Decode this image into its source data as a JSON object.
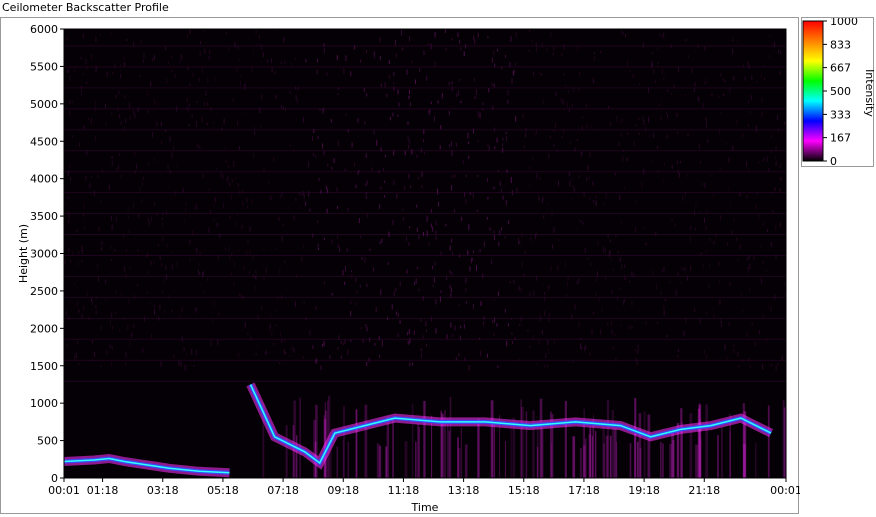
{
  "window": {
    "title": "Ceilometer Backscatter Profile"
  },
  "chart_data": {
    "type": "heatmap",
    "xlabel": "Time",
    "ylabel": "Height (m)",
    "x_ticks": [
      "00:01",
      "01:18",
      "03:18",
      "05:18",
      "07:18",
      "09:18",
      "11:18",
      "13:18",
      "15:18",
      "17:18",
      "19:18",
      "21:18",
      "00:01"
    ],
    "x_tick_hours": [
      0,
      1.283,
      3.283,
      5.283,
      7.283,
      9.283,
      11.283,
      13.283,
      15.283,
      17.283,
      19.283,
      21.283,
      24
    ],
    "y_ticks": [
      0,
      500,
      1000,
      1500,
      2000,
      2500,
      3000,
      3500,
      4000,
      4500,
      5000,
      5500,
      6000
    ],
    "ylim": [
      0,
      6000
    ],
    "xlim_hours": [
      0,
      24
    ],
    "colorbar": {
      "label": "Intensity",
      "ticks": [
        "1000",
        "833",
        "667",
        "500",
        "333",
        "167",
        "0"
      ],
      "range": [
        0,
        1000
      ],
      "colors": [
        "#ff0000",
        "#ff8000",
        "#ffff00",
        "#00ff00",
        "#00ffff",
        "#0000ff",
        "#ff00ff",
        "#000000"
      ]
    },
    "cloud_base_layer": [
      {
        "hour": 0.0,
        "height": 220
      },
      {
        "hour": 0.5,
        "height": 230
      },
      {
        "hour": 1.0,
        "height": 240
      },
      {
        "hour": 1.5,
        "height": 260
      },
      {
        "hour": 2.0,
        "height": 220
      },
      {
        "hour": 2.5,
        "height": 190
      },
      {
        "hour": 3.0,
        "height": 160
      },
      {
        "hour": 3.5,
        "height": 130
      },
      {
        "hour": 4.0,
        "height": 110
      },
      {
        "hour": 4.5,
        "height": 90
      },
      {
        "hour": 5.0,
        "height": 80
      },
      {
        "hour": 5.5,
        "height": 70
      },
      {
        "hour": 6.2,
        "height": 1250
      },
      {
        "hour": 7.0,
        "height": 550
      },
      {
        "hour": 7.5,
        "height": 450
      },
      {
        "hour": 8.0,
        "height": 350
      },
      {
        "hour": 8.5,
        "height": 200
      },
      {
        "hour": 9.0,
        "height": 600
      },
      {
        "hour": 10.0,
        "height": 700
      },
      {
        "hour": 11.0,
        "height": 800
      },
      {
        "hour": 12.5,
        "height": 750
      },
      {
        "hour": 14.0,
        "height": 750
      },
      {
        "hour": 15.5,
        "height": 700
      },
      {
        "hour": 17.0,
        "height": 750
      },
      {
        "hour": 18.5,
        "height": 700
      },
      {
        "hour": 19.5,
        "height": 550
      },
      {
        "hour": 20.5,
        "height": 650
      },
      {
        "hour": 21.5,
        "height": 700
      },
      {
        "hour": 22.5,
        "height": 800
      },
      {
        "hour": 23.5,
        "height": 600
      }
    ]
  }
}
